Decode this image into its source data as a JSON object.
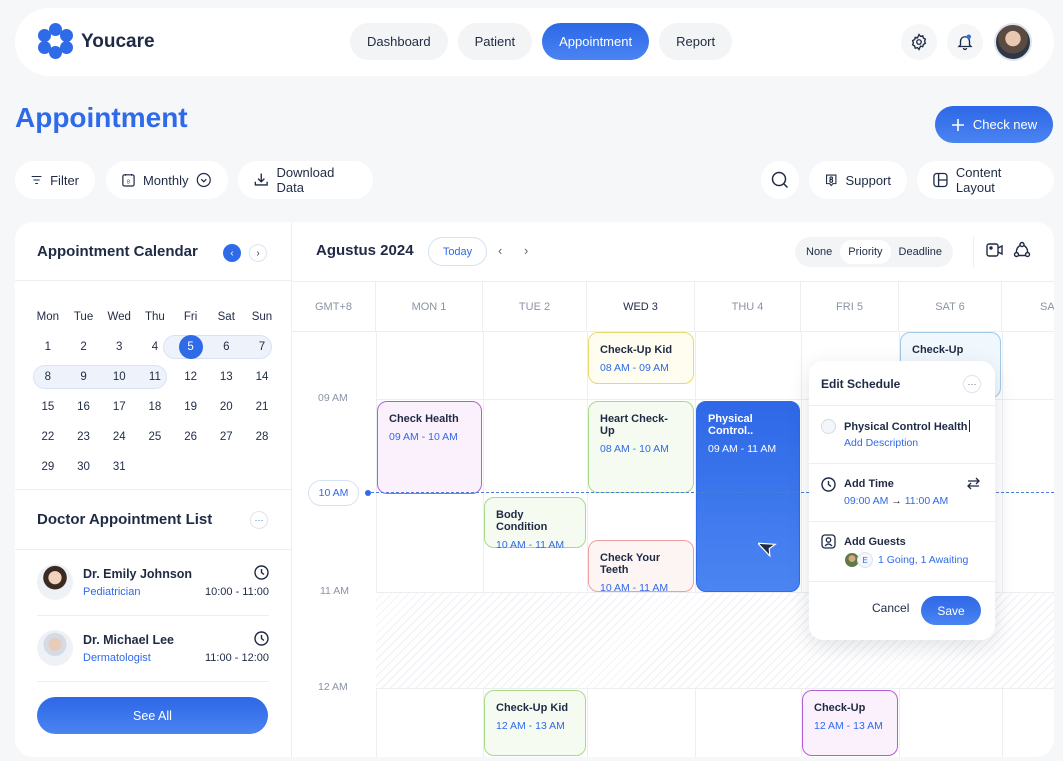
{
  "brand": {
    "name": "Youcare"
  },
  "nav": {
    "items": [
      {
        "label": "Dashboard",
        "active": false
      },
      {
        "label": "Patient",
        "active": false
      },
      {
        "label": "Appointment",
        "active": true
      },
      {
        "label": "Report",
        "active": false
      }
    ]
  },
  "header_icons": [
    "gear-icon",
    "bell-icon",
    "user-avatar"
  ],
  "page": {
    "title": "Appointment",
    "check_new_label": "Check new"
  },
  "toolbar": {
    "filter_label": "Filter",
    "view_label": "Monthly",
    "download_label": "Download Data",
    "support_label": "Support",
    "layout_label": "Content Layout"
  },
  "mini_calendar": {
    "title": "Appointment Calendar",
    "weekdays": [
      "Mon",
      "Tue",
      "Wed",
      "Thu",
      "Fri",
      "Sat",
      "Sun"
    ],
    "weeks": [
      [
        "1",
        "2",
        "3",
        "4",
        "5",
        "6",
        "7"
      ],
      [
        "8",
        "9",
        "10",
        "11",
        "12",
        "13",
        "14"
      ],
      [
        "15",
        "16",
        "17",
        "18",
        "19",
        "20",
        "21"
      ],
      [
        "22",
        "23",
        "24",
        "25",
        "26",
        "27",
        "28"
      ],
      [
        "29",
        "30",
        "31",
        "",
        "",
        "",
        ""
      ]
    ],
    "selected_day": "5",
    "highlighted_range": [
      "5",
      "11"
    ]
  },
  "doctor_list": {
    "title": "Doctor Appointment List",
    "doctors": [
      {
        "name": "Dr. Emily Johnson",
        "specialty": "Pediatrician",
        "time": "10:00 - 11:00"
      },
      {
        "name": "Dr. Michael Lee",
        "specialty": "Dermatologist",
        "time": "11:00 - 12:00"
      }
    ],
    "see_all_label": "See All"
  },
  "schedule": {
    "month_label": "Agustus 2024",
    "today_label": "Today",
    "sort_options": [
      {
        "label": "None",
        "active": false
      },
      {
        "label": "Priority",
        "active": true
      },
      {
        "label": "Deadline",
        "active": false
      }
    ],
    "timezone_label": "GMT+8",
    "days": [
      {
        "label": "MON 1",
        "current": false
      },
      {
        "label": "TUE 2",
        "current": false
      },
      {
        "label": "WED 3",
        "current": true
      },
      {
        "label": "THU 4",
        "current": false
      },
      {
        "label": "FRI 5",
        "current": false
      },
      {
        "label": "SAT 6",
        "current": false
      },
      {
        "label": "SA",
        "current": false
      }
    ],
    "time_labels": [
      "09 AM",
      "11 AM",
      "12 AM"
    ],
    "now_label": "10 AM",
    "events": [
      {
        "title": "Check-Up Kid",
        "time": "08 AM - 09 AM",
        "day": "WED 3",
        "color": "#e9d86a",
        "bg": "#fffdf0"
      },
      {
        "title": "Check Health",
        "time": "09 AM - 10 AM",
        "day": "MON 1",
        "color": "#b45fd1",
        "bg": "#fbf1fd"
      },
      {
        "title": "Heart Check-Up",
        "time": "08 AM - 10 AM",
        "day": "WED 3",
        "color": "#a9d98a",
        "bg": "#f6fbf1"
      },
      {
        "title": "Physical Control..",
        "time": "09 AM - 11 AM",
        "day": "THU 4",
        "color": "#2f6ae8",
        "bg": "#2f6ae8"
      },
      {
        "title": "Check-Up",
        "time": "",
        "day": "SAT 6",
        "color": "#9fc8e6",
        "bg": "#f1f8fd"
      },
      {
        "title": "Body Condition",
        "time": "10 AM - 11 AM",
        "day": "TUE 2",
        "color": "#a9d98a",
        "bg": "#f6fbf1"
      },
      {
        "title": "Check Your Teeth",
        "time": "10 AM - 11 AM",
        "day": "WED 3",
        "color": "#ee9f9f",
        "bg": "#fdf4f4"
      },
      {
        "title": "Check-Up Kid",
        "time": "12 AM - 13 AM",
        "day": "TUE 2",
        "color": "#a9d98a",
        "bg": "#f6fbf1"
      },
      {
        "title": "Check-Up",
        "time": "12 AM - 13 AM",
        "day": "FRI 5",
        "color": "#b45fd1",
        "bg": "#fbf1fd"
      }
    ]
  },
  "edit_schedule": {
    "title": "Edit Schedule",
    "event_name": "Physical Control Health",
    "add_description_label": "Add Description",
    "add_time_label": "Add Time",
    "start_time": "09:00 AM",
    "end_time": "11:00 AM",
    "add_guests_label": "Add Guests",
    "guest_initial": "E",
    "guest_status": "1 Going, 1 Awaiting",
    "cancel_label": "Cancel",
    "save_label": "Save"
  },
  "colors": {
    "accent": "#2f6ae8",
    "text": "#1f2a44",
    "muted": "#8a93a6",
    "background": "#f6f7f9"
  }
}
